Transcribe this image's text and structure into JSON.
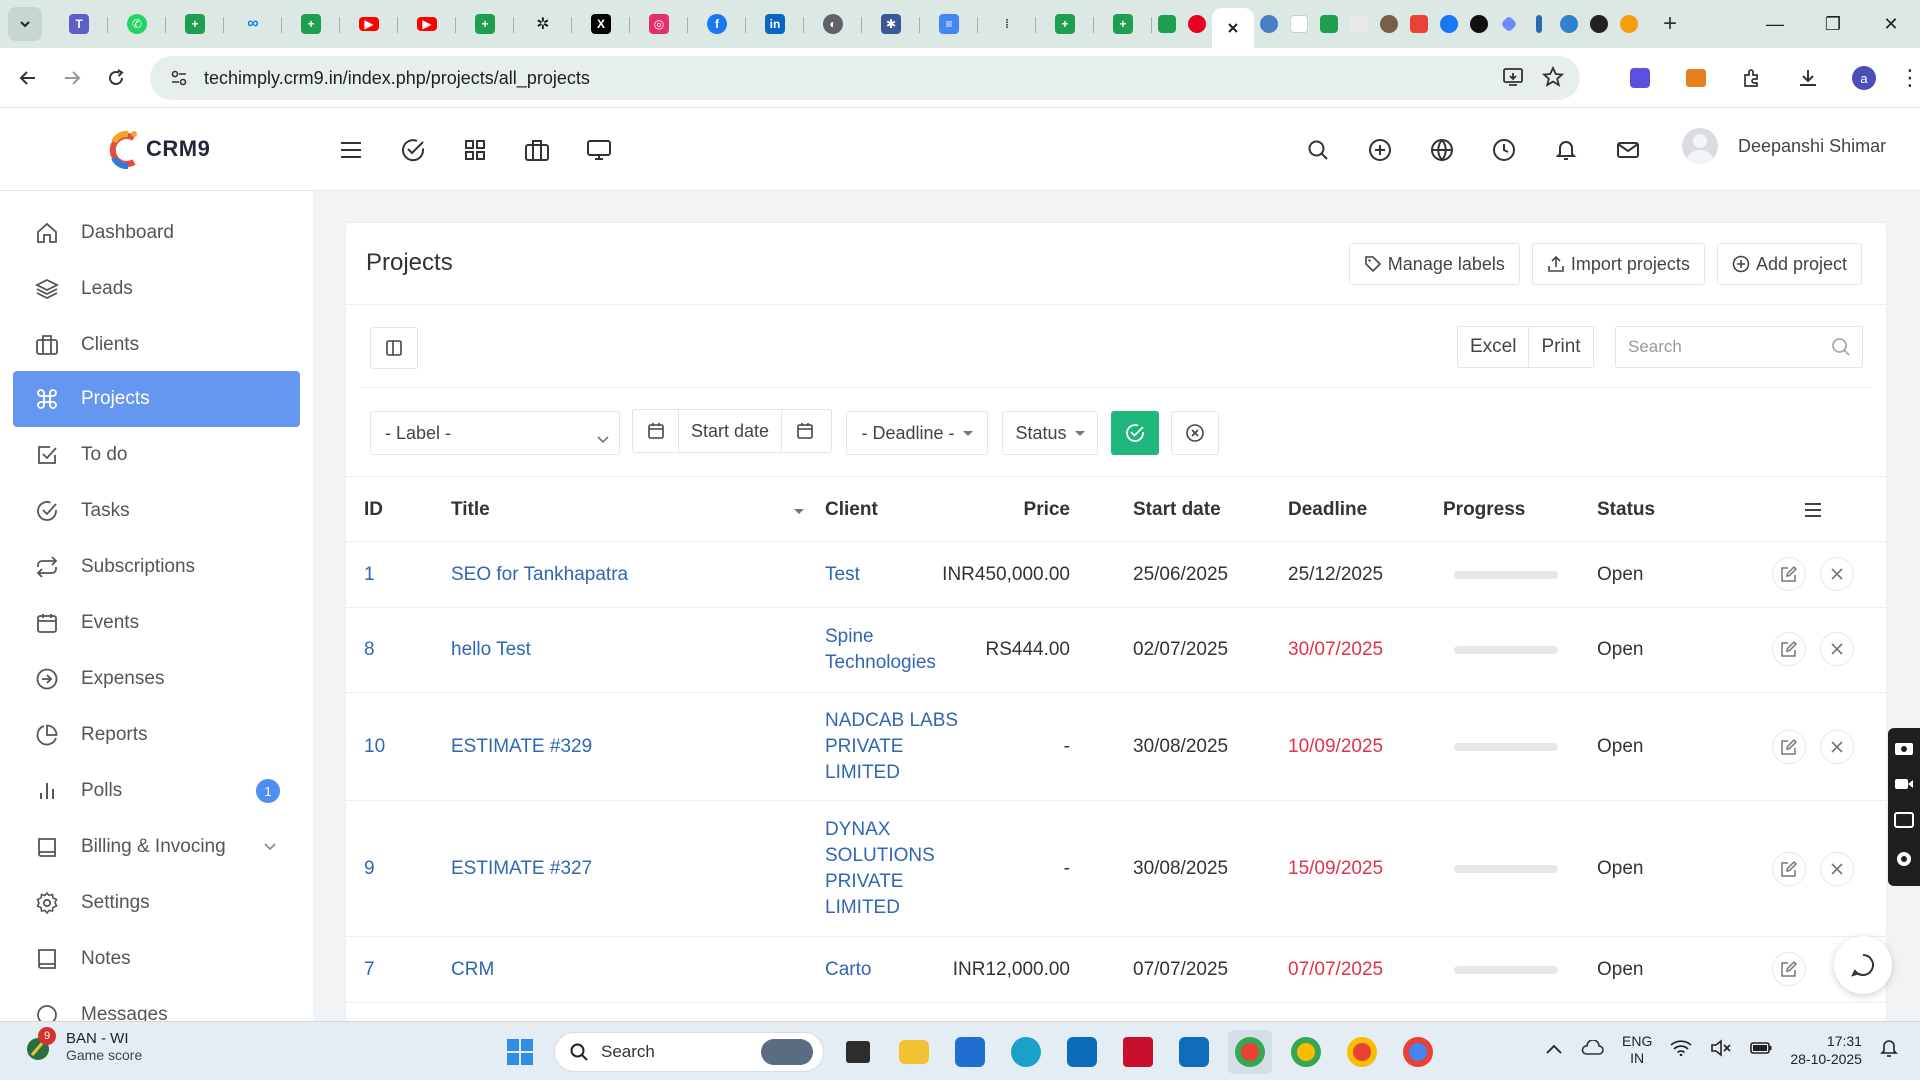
{
  "browser": {
    "url": "techimply.crm9.in/index.php/projects/all_projects",
    "tab_favicons": [
      "dropdown",
      "teams",
      "whatsapp",
      "sheets",
      "meta",
      "sheets",
      "youtube",
      "youtube",
      "sheets",
      "openai",
      "x",
      "instagram",
      "facebook",
      "linkedin",
      "globe",
      "puzzle",
      "docs",
      "extension",
      "sheets",
      "sheets",
      "sheets",
      "pinterest",
      "close"
    ]
  },
  "app": {
    "logo_text": "CRM9",
    "user_name": "Deepanshi Shimar"
  },
  "sidebar": {
    "items": [
      {
        "label": "Dashboard",
        "icon": "home-icon"
      },
      {
        "label": "Leads",
        "icon": "layers-icon"
      },
      {
        "label": "Clients",
        "icon": "briefcase-icon"
      },
      {
        "label": "Projects",
        "icon": "command-icon",
        "active": true
      },
      {
        "label": "To do",
        "icon": "check-square-icon"
      },
      {
        "label": "Tasks",
        "icon": "check-circle-icon"
      },
      {
        "label": "Subscriptions",
        "icon": "repeat-icon"
      },
      {
        "label": "Events",
        "icon": "calendar-icon"
      },
      {
        "label": "Expenses",
        "icon": "arrow-circle-icon"
      },
      {
        "label": "Reports",
        "icon": "pie-chart-icon"
      },
      {
        "label": "Polls",
        "icon": "bar-chart-icon",
        "badge": "1"
      },
      {
        "label": "Billing & Invocing",
        "icon": "book-icon"
      },
      {
        "label": "Settings",
        "icon": "gear-icon"
      },
      {
        "label": "Notes",
        "icon": "notebook-icon"
      },
      {
        "label": "Messages",
        "icon": "message-icon"
      }
    ]
  },
  "page": {
    "title": "Projects",
    "buttons": {
      "manage_labels": "Manage labels",
      "import_projects": "Import projects",
      "add_project": "Add project"
    },
    "export": {
      "excel": "Excel",
      "print": "Print"
    },
    "search_placeholder": "Search",
    "filters": {
      "label": "- Label -",
      "start_date": "Start date",
      "deadline": "- Deadline -",
      "status": "Status"
    }
  },
  "table": {
    "headers": {
      "id": "ID",
      "title": "Title",
      "client": "Client",
      "price": "Price",
      "start_date": "Start date",
      "deadline": "Deadline",
      "progress": "Progress",
      "status": "Status"
    },
    "rows": [
      {
        "id": "1",
        "title": "SEO for Tankhapatra",
        "client": "Test",
        "price": "INR450,000.00",
        "start_date": "25/06/2025",
        "deadline": "25/12/2025",
        "deadline_overdue": false,
        "progress": 0,
        "status": "Open"
      },
      {
        "id": "8",
        "title": "hello Test",
        "client": "Spine\nTechnologies",
        "price": "RS444.00",
        "start_date": "02/07/2025",
        "deadline": "30/07/2025",
        "deadline_overdue": true,
        "progress": 0,
        "status": "Open"
      },
      {
        "id": "10",
        "title": "ESTIMATE #329",
        "client": "NADCAB LABS\nPRIVATE\nLIMITED",
        "price": "-",
        "start_date": "30/08/2025",
        "deadline": "10/09/2025",
        "deadline_overdue": true,
        "progress": 0,
        "status": "Open"
      },
      {
        "id": "9",
        "title": "ESTIMATE #327",
        "client": "DYNAX\nSOLUTIONS\nPRIVATE\nLIMITED",
        "price": "-",
        "start_date": "30/08/2025",
        "deadline": "15/09/2025",
        "deadline_overdue": true,
        "progress": 0,
        "status": "Open"
      },
      {
        "id": "7",
        "title": "CRM",
        "client": "Carto",
        "price": "INR12,000.00",
        "start_date": "07/07/2025",
        "deadline": "07/07/2025",
        "deadline_overdue": true,
        "progress": 0,
        "status": "Open"
      }
    ]
  },
  "taskbar": {
    "weather_title": "BAN - WI",
    "weather_sub": "Game score",
    "weather_badge": "9",
    "search_label": "Search",
    "lang1": "ENG",
    "lang2": "IN",
    "time": "17:31",
    "date": "28-10-2025"
  },
  "colors": {
    "accent": "#6697f0",
    "link": "#2f67b2",
    "overdue": "#e0324b",
    "success": "#1fb77b"
  }
}
